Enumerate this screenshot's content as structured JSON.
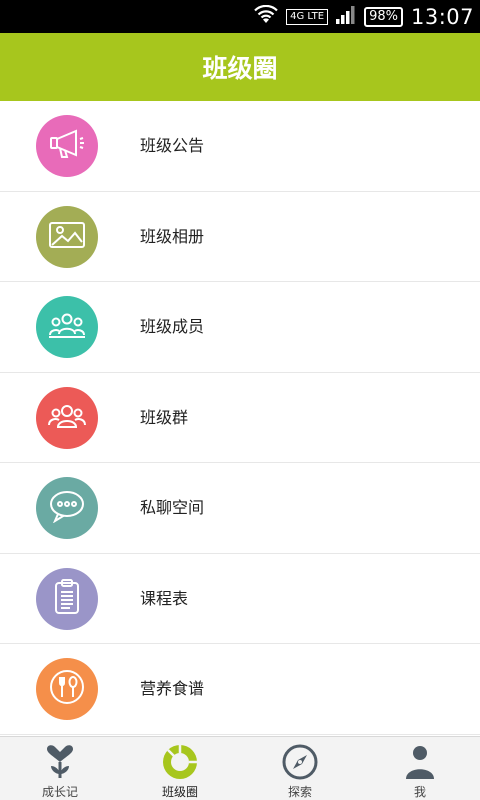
{
  "status": {
    "network": "4G LTE",
    "battery": "98%",
    "time": "13:07"
  },
  "header": {
    "title": "班级圈"
  },
  "menu": [
    {
      "label": "班级公告",
      "icon": "megaphone-icon",
      "color": "#e86bb9"
    },
    {
      "label": "班级相册",
      "icon": "photo-icon",
      "color": "#a3ad55"
    },
    {
      "label": "班级成员",
      "icon": "members-icon",
      "color": "#3cc0a9"
    },
    {
      "label": "班级群",
      "icon": "group-icon",
      "color": "#ec5a57"
    },
    {
      "label": "私聊空间",
      "icon": "chat-bubble-icon",
      "color": "#6aaaa3"
    },
    {
      "label": "课程表",
      "icon": "clipboard-icon",
      "color": "#9a95c8"
    },
    {
      "label": "营养食谱",
      "icon": "fork-spoon-icon",
      "color": "#f58f4a"
    }
  ],
  "tabs": [
    {
      "label": "成长记",
      "icon": "heart-plant-icon"
    },
    {
      "label": "班级圈",
      "icon": "class-circle-icon",
      "active": true
    },
    {
      "label": "探索",
      "icon": "compass-icon"
    },
    {
      "label": "我",
      "icon": "person-icon"
    }
  ],
  "colors": {
    "accent": "#a7c61d",
    "tab_icon": "#4f5b66"
  }
}
